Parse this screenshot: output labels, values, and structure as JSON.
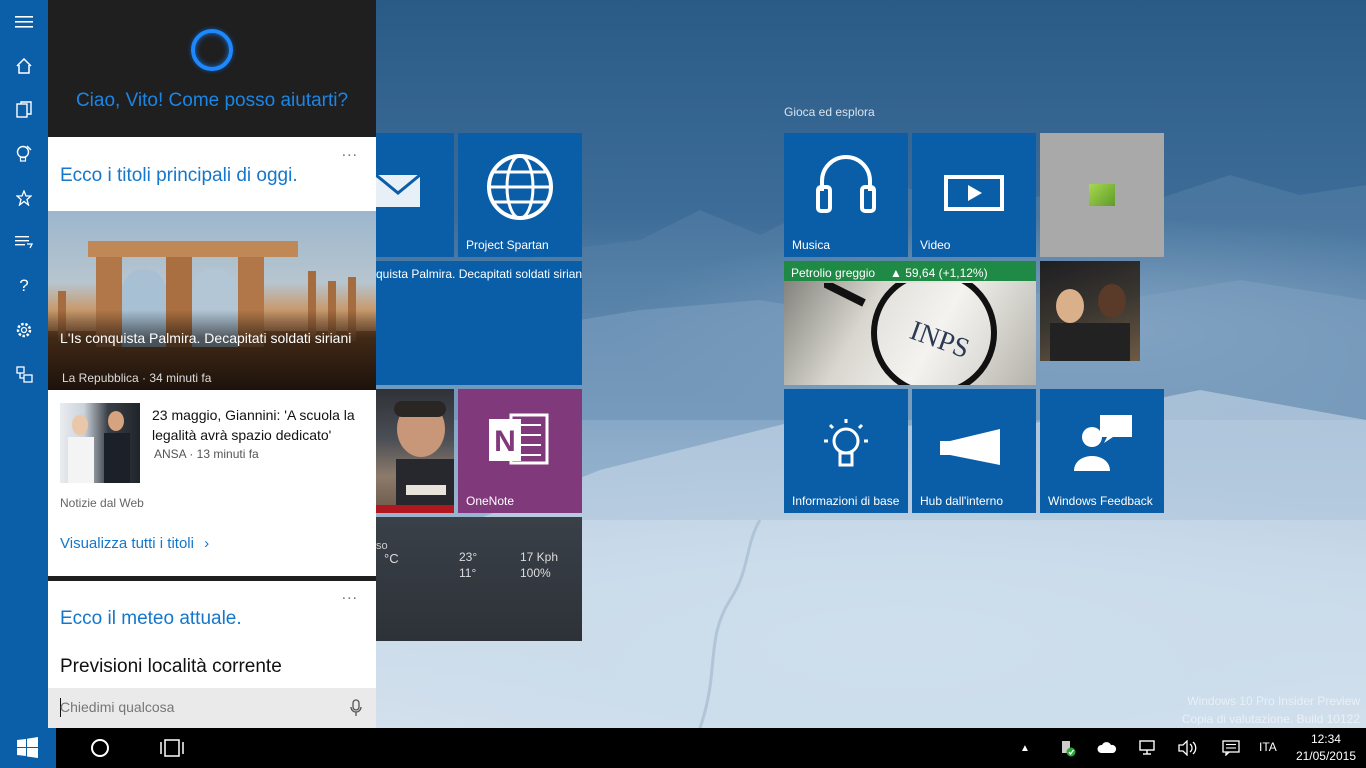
{
  "cortana": {
    "greeting": "Ciao, Vito! Come posso aiutarti?",
    "headlines_card": {
      "title": "Ecco i titoli principali di oggi.",
      "more": "...",
      "hero": {
        "title": "L'Is conquista Palmira. Decapitati soldati siriani",
        "source": "La Repubblica · 34 minuti fa"
      },
      "second": {
        "title": "23 maggio, Giannini: 'A scuola la legalità avrà spazio dedicato'",
        "source": "ANSA · 13 minuti fa"
      },
      "footnote": "Notizie dal Web",
      "see_all": "Visualizza tutti i titoli",
      "chevron": "›"
    },
    "weather_card": {
      "title": "Ecco il meteo attuale.",
      "more": "...",
      "subtitle": "Previsioni località corrente"
    },
    "ask_box": {
      "placeholder": "Chiedimi qualcosa",
      "mic_icon": "microphone-icon"
    }
  },
  "rail": {
    "icons": [
      "hamburger-icon",
      "home-icon",
      "notebook-icon",
      "reminders-icon",
      "favorites-icon",
      "feedback-icon",
      "help-icon",
      "settings-icon",
      "connect-icon"
    ]
  },
  "tiles": {
    "group_title": "Gioca ed esplora",
    "project_spartan": "Project Spartan",
    "news_partial": "quista Palmira. Decapitati soldati siriani",
    "onenote": "OneNote",
    "weather": {
      "partial_city": "so",
      "unit": "°C",
      "hi": "23°",
      "lo": "11°",
      "wind": "17 Kph",
      "humidity": "100%"
    },
    "music": "Musica",
    "video": "Video",
    "money": {
      "name": "Petrolio greggio",
      "value": "▲ 59,64 (+1,12%)"
    },
    "get_started": "Informazioni di base",
    "insider_hub": "Hub dall'interno",
    "windows_feedback": "Windows Feedback"
  },
  "watermark": {
    "line1": "Windows 10 Pro Insider Preview",
    "line2": "Copia di valutazione. Build 10122"
  },
  "taskbar": {
    "language": "ITA",
    "time": "12:34",
    "date": "21/05/2015"
  },
  "colors": {
    "accent": "#0b5ea8",
    "cortana_blue": "#1a86e6",
    "onenote": "#80397b",
    "money_green": "#1f8a45"
  }
}
